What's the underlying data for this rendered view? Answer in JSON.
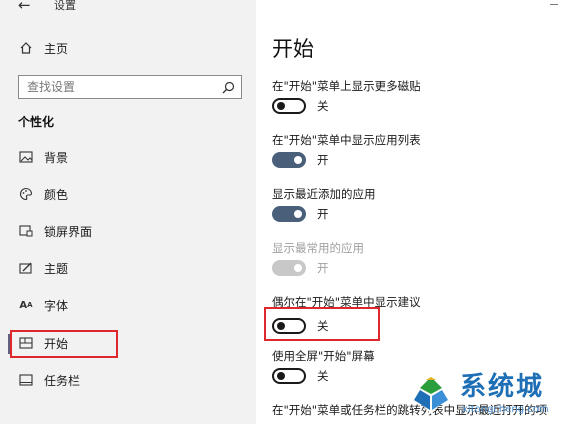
{
  "window": {
    "title": "设置"
  },
  "sidebar": {
    "home": "主页",
    "search_placeholder": "查找设置",
    "section": "个性化",
    "items": [
      {
        "label": "背景",
        "icon": "image-icon"
      },
      {
        "label": "颜色",
        "icon": "palette-icon"
      },
      {
        "label": "锁屏界面",
        "icon": "lock-screen-icon"
      },
      {
        "label": "主题",
        "icon": "theme-icon"
      },
      {
        "label": "字体",
        "icon": "font-icon"
      },
      {
        "label": "开始",
        "icon": "start-icon",
        "selected": true
      },
      {
        "label": "任务栏",
        "icon": "taskbar-icon"
      }
    ]
  },
  "main": {
    "title": "开始",
    "settings": [
      {
        "label": "在\"开始\"菜单上显示更多磁贴",
        "state": "关",
        "on": false
      },
      {
        "label": "在\"开始\"菜单中显示应用列表",
        "state": "开",
        "on": true
      },
      {
        "label": "显示最近添加的应用",
        "state": "开",
        "on": true
      },
      {
        "label": "显示最常用的应用",
        "state": "开",
        "on": true,
        "disabled": true
      },
      {
        "label": "偶尔在\"开始\"菜单中显示建议",
        "state": "关",
        "on": false
      },
      {
        "label": "使用全屏\"开始\"屏幕",
        "state": "关",
        "on": false
      },
      {
        "label": "在\"开始\"菜单或任务栏的跳转列表中显示最近打开的项"
      }
    ]
  },
  "watermark": {
    "text": "系统城",
    "url": "xitongcheng.com"
  },
  "colors": {
    "accent": "#4a5f7a",
    "highlight": "#e0282c",
    "watermark": "#1e6fb5"
  }
}
